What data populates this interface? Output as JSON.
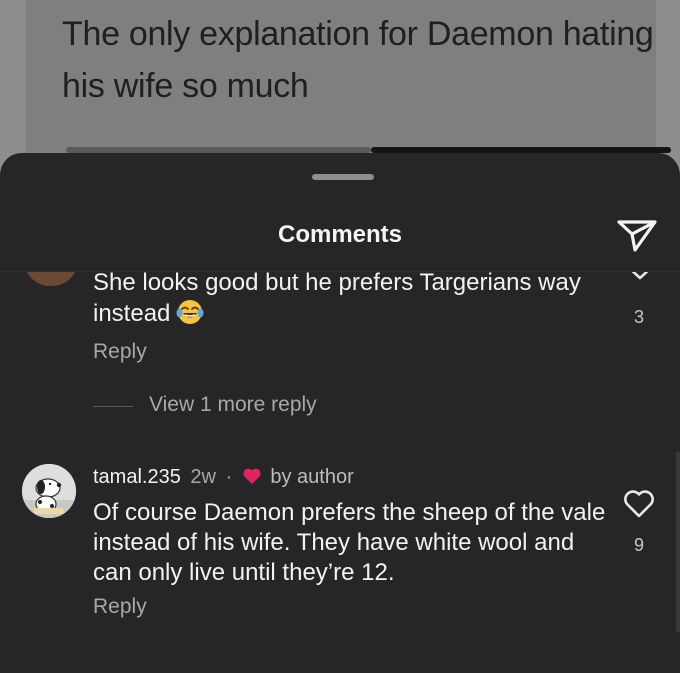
{
  "post": {
    "text": "The only explanation for Daemon hating his wife so much"
  },
  "sheet": {
    "title": "Comments",
    "share_icon": "paper-plane-icon"
  },
  "comments": [
    {
      "text": "She looks good but he prefers Targerians way instead",
      "emoji": "tears-of-joy-emoji",
      "reply_label": "Reply",
      "likes": "3",
      "view_more_label": "View 1 more reply"
    },
    {
      "username": "tamal.235",
      "time": "2w",
      "separator": "·",
      "by_author_label": "by author",
      "text": "Of course Daemon prefers the sheep of the vale instead of his wife. They have white wool and can only live until they’re 12.",
      "reply_label": "Reply",
      "likes": "9"
    }
  ],
  "colors": {
    "sheet_bg": "#262628",
    "author_heart": "#e0245e",
    "text_primary": "#f2f2f2",
    "text_secondary": "#a8a8aa"
  }
}
